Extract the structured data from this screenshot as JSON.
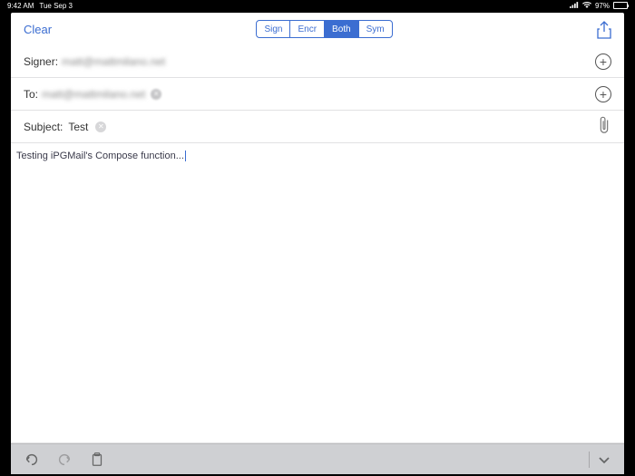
{
  "status_bar": {
    "time": "9:42 AM",
    "date": "Tue Sep 3",
    "battery_pct": "97%"
  },
  "top_bar": {
    "clear_label": "Clear",
    "segments": {
      "sign": "Sign",
      "encr": "Encr",
      "both": "Both",
      "sym": "Sym"
    }
  },
  "fields": {
    "signer_label": "Signer:",
    "signer_value": "matt@mattmilano.net",
    "to_label": "To:",
    "to_value": "matt@mattmilano.net",
    "subject_label": "Subject:",
    "subject_value": "Test"
  },
  "body": {
    "text": "Testing iPGMail's Compose function..."
  }
}
